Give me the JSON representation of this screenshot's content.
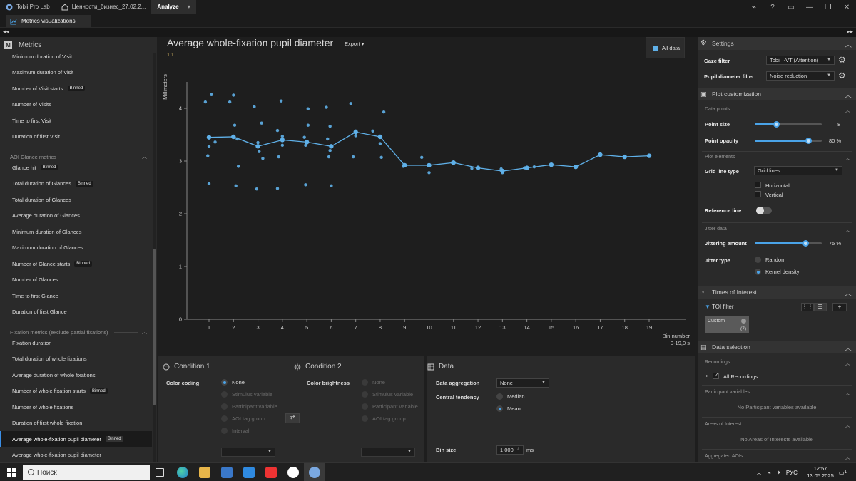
{
  "titlebar": {
    "tabs": [
      {
        "label": "Tobii Pro Lab"
      },
      {
        "label": "Ценности_бизнес_27.02.2..."
      },
      {
        "label": "Analyze"
      }
    ]
  },
  "subtab": {
    "label": "Metrics visualizations"
  },
  "metrics_panel": {
    "title": "Metrics",
    "items": [
      {
        "label": "Minimum duration of Visit"
      },
      {
        "label": "Maximum duration of Visit"
      },
      {
        "label": "Number of Visit starts",
        "badge": "Binned"
      },
      {
        "label": "Number of Visits"
      },
      {
        "label": "Time to first Visit"
      },
      {
        "label": "Duration of first Visit"
      },
      {
        "group": "AOI Glance metrics"
      },
      {
        "label": "Glance hit",
        "badge": "Binned"
      },
      {
        "label": "Total duration of Glances",
        "badge": "Binned"
      },
      {
        "label": "Total duration of Glances"
      },
      {
        "label": "Average duration of Glances"
      },
      {
        "label": "Minimum duration of Glances"
      },
      {
        "label": "Maximum duration of Glances"
      },
      {
        "label": "Number of Glance starts",
        "badge": "Binned"
      },
      {
        "label": "Number of Glances"
      },
      {
        "label": "Time to first Glance"
      },
      {
        "label": "Duration of first Glance"
      },
      {
        "group": "Fixation metrics (exclude partial fixations)"
      },
      {
        "label": "Fixation duration"
      },
      {
        "label": "Total duration of whole fixations"
      },
      {
        "label": "Average duration of whole fixations"
      },
      {
        "label": "Number of whole fixation starts",
        "badge": "Binned"
      },
      {
        "label": "Number of whole fixations"
      },
      {
        "label": "Duration of first whole fixation"
      },
      {
        "label": "Average whole-fixation pupil diameter",
        "badge": "Binned",
        "selected": true
      },
      {
        "label": "Average whole-fixation pupil diameter"
      }
    ]
  },
  "chart_header": {
    "title": "Average whole-fixation pupil diameter",
    "export_label": "Export",
    "subtitle": "1.1",
    "legend_label": "All data"
  },
  "chart_data": {
    "type": "scatter",
    "ylabel": "Millimeters",
    "xlabel": "Bin number",
    "xlabel_sub": "0-19,0 s",
    "ylim": [
      0,
      4.5
    ],
    "y_ticks": [
      0,
      1,
      2,
      3,
      4
    ],
    "categories": [
      1,
      2,
      3,
      4,
      5,
      6,
      7,
      8,
      9,
      10,
      11,
      12,
      13,
      14,
      15,
      16,
      17,
      18,
      19
    ],
    "mean_line": [
      3.45,
      3.46,
      3.28,
      3.4,
      3.36,
      3.28,
      3.55,
      3.46,
      2.92,
      2.92,
      2.97,
      2.87,
      2.81,
      2.87,
      2.93,
      2.89,
      3.12,
      3.08,
      3.1
    ],
    "points": [
      [
        0.85,
        4.12
      ],
      [
        1.1,
        4.26
      ],
      [
        1.0,
        3.28
      ],
      [
        1.25,
        3.36
      ],
      [
        0.95,
        3.1
      ],
      [
        1.0,
        2.57
      ],
      [
        1.85,
        4.12
      ],
      [
        2.0,
        4.25
      ],
      [
        2.05,
        3.68
      ],
      [
        2.15,
        3.42
      ],
      [
        2.2,
        2.9
      ],
      [
        2.1,
        2.53
      ],
      [
        2.85,
        4.03
      ],
      [
        3.15,
        3.72
      ],
      [
        3.0,
        3.35
      ],
      [
        3.2,
        3.05
      ],
      [
        2.95,
        2.47
      ],
      [
        3.05,
        3.18
      ],
      [
        3.8,
        3.58
      ],
      [
        3.95,
        4.14
      ],
      [
        4.0,
        3.47
      ],
      [
        4.0,
        3.3
      ],
      [
        3.85,
        3.08
      ],
      [
        3.8,
        2.48
      ],
      [
        4.9,
        3.45
      ],
      [
        5.05,
        3.99
      ],
      [
        5.05,
        3.68
      ],
      [
        4.95,
        3.3
      ],
      [
        4.95,
        2.55
      ],
      [
        5.8,
        4.02
      ],
      [
        5.85,
        3.42
      ],
      [
        5.95,
        3.66
      ],
      [
        5.95,
        3.2
      ],
      [
        5.9,
        3.08
      ],
      [
        6.0,
        2.53
      ],
      [
        6.8,
        4.09
      ],
      [
        7.0,
        3.57
      ],
      [
        7.0,
        3.48
      ],
      [
        6.9,
        3.08
      ],
      [
        7.7,
        3.57
      ],
      [
        8.15,
        3.93
      ],
      [
        8.0,
        3.33
      ],
      [
        8.05,
        3.07
      ],
      [
        8.95,
        2.9
      ],
      [
        9.7,
        3.07
      ],
      [
        10.0,
        2.78
      ],
      [
        10.95,
        2.97
      ],
      [
        11.75,
        2.86
      ],
      [
        12.95,
        2.85
      ],
      [
        13.0,
        2.78
      ],
      [
        13.9,
        2.87
      ],
      [
        14.3,
        2.89
      ],
      [
        16.0,
        2.89
      ]
    ]
  },
  "condition1": {
    "title": "Condition 1",
    "color_coding_label": "Color coding",
    "options": [
      "None",
      "Stimulus variable",
      "Participant variable",
      "AOI tag group",
      "Interval"
    ]
  },
  "condition2": {
    "title": "Condition 2",
    "color_brightness_label": "Color brightness",
    "options": [
      "None",
      "Stimulus variable",
      "Participant variable",
      "AOI tag group"
    ]
  },
  "data_panel": {
    "title": "Data",
    "aggregation_label": "Data aggregation",
    "aggregation_value": "None",
    "central_tendency_label": "Central tendency",
    "central_options": [
      "Median",
      "Mean"
    ],
    "bin_size_label": "Bin size",
    "bin_size_value": "1 000",
    "bin_size_unit": "ms"
  },
  "settings": {
    "title": "Settings",
    "gaze_filter_label": "Gaze filter",
    "gaze_filter_value": "Tobii I-VT (Attention)",
    "pupil_filter_label": "Pupil diameter filter",
    "pupil_filter_value": "Noise reduction"
  },
  "plot_customization": {
    "title": "Plot customization",
    "data_points_head": "Data points",
    "point_size_label": "Point size",
    "point_size_value": "8",
    "point_size_fraction": 0.32,
    "point_opacity_label": "Point opacity",
    "point_opacity_value": "80",
    "point_opacity_unit": "%",
    "point_opacity_fraction": 0.8,
    "plot_elements_head": "Plot elements",
    "grid_line_label": "Grid line type",
    "grid_line_value": "Grid lines",
    "horizontal_label": "Horizontal",
    "vertical_label": "Vertical",
    "reference_line_label": "Reference line",
    "jitter_head": "Jitter data",
    "jitter_amount_label": "Jittering amount",
    "jitter_amount_value": "75",
    "jitter_amount_unit": "%",
    "jitter_amount_fraction": 0.75,
    "jitter_type_label": "Jitter type",
    "jitter_options": [
      "Random",
      "Kernel density"
    ]
  },
  "toi": {
    "title": "Times of Interest",
    "filter_label": "TOI filter",
    "chip_label": "Custom",
    "chip_count": "(7)"
  },
  "data_selection": {
    "title": "Data selection",
    "recordings_head": "Recordings",
    "all_recordings_label": "All Recordings",
    "participant_head": "Participant variables",
    "participant_empty": "No Participant variables available",
    "aoi_head": "Areas of Interest",
    "aoi_empty": "No Areas of Interests available",
    "aggregated_head": "Aggregated AOIs"
  },
  "taskbar": {
    "search_label": "Поиск",
    "lang": "РУС",
    "time": "12:57",
    "date": "13.05.2025",
    "notif_count": "1"
  },
  "colors": {
    "accent": "#4aa3e8",
    "point": "#5fb0e8"
  }
}
